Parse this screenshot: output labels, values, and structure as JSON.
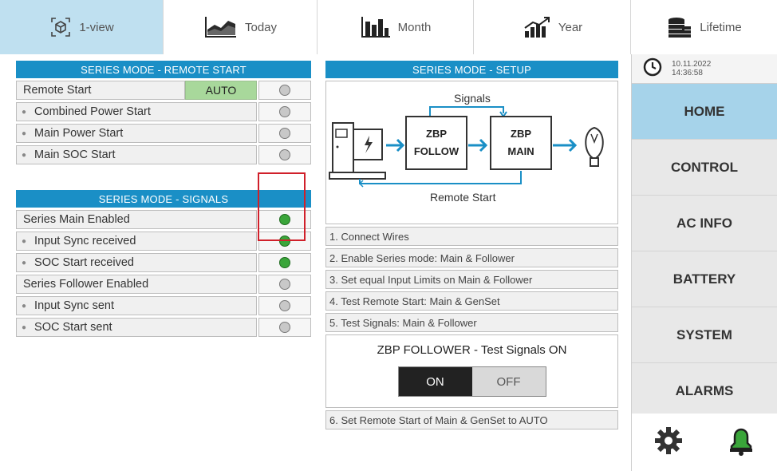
{
  "tabs": [
    {
      "label": "1-view",
      "icon": "network-cube-icon",
      "active": true
    },
    {
      "label": "Today",
      "icon": "area-chart-icon"
    },
    {
      "label": "Month",
      "icon": "bar-chart-icon"
    },
    {
      "label": "Year",
      "icon": "trend-chart-icon"
    },
    {
      "label": "Lifetime",
      "icon": "coins-stack-icon"
    }
  ],
  "remote_start": {
    "header": "SERIES MODE - REMOTE START",
    "rows": [
      {
        "label": "Remote Start",
        "value": "AUTO",
        "led": "off"
      },
      {
        "label": "Combined Power Start",
        "led": "off"
      },
      {
        "label": "Main Power Start",
        "led": "off"
      },
      {
        "label": "Main SOC Start",
        "led": "off"
      }
    ]
  },
  "signals": {
    "header": "SERIES MODE - SIGNALS",
    "rows": [
      {
        "label": "Series Main Enabled",
        "led": "on"
      },
      {
        "label": "Input Sync received",
        "led": "on"
      },
      {
        "label": "SOC Start received",
        "led": "on"
      },
      {
        "label": "Series Follower Enabled",
        "led": "off"
      },
      {
        "label": "Input Sync sent",
        "led": "off"
      },
      {
        "label": "SOC Start sent",
        "led": "off"
      }
    ]
  },
  "setup": {
    "header": "SERIES MODE - SETUP",
    "diagram": {
      "signals_label": "Signals",
      "follow_label_1": "ZBP",
      "follow_label_2": "FOLLOW",
      "main_label_1": "ZBP",
      "main_label_2": "MAIN",
      "remote_label": "Remote Start"
    },
    "steps": [
      "1. Connect Wires",
      "2. Enable Series mode: Main & Follower",
      "3. Set equal Input Limits on Main & Follower",
      "4. Test Remote Start: Main & GenSet",
      "5. Test Signals: Main & Follower"
    ],
    "test": {
      "title": "ZBP FOLLOWER - Test Signals ON",
      "on_label": "ON",
      "off_label": "OFF",
      "selected": "ON"
    },
    "step6": "6. Set Remote Start of Main & GenSet to AUTO"
  },
  "sidebar": {
    "date": "10.11.2022",
    "time": "14:36:58",
    "items": [
      "HOME",
      "CONTROL",
      "AC INFO",
      "BATTERY",
      "SYSTEM",
      "ALARMS"
    ],
    "active_item": "HOME"
  },
  "colors": {
    "header_blue": "#1a8fc6",
    "active_tab": "#bfe0f0",
    "auto_green": "#a8d89b",
    "led_on": "#3aa53a",
    "highlight_red": "#d0202a"
  }
}
